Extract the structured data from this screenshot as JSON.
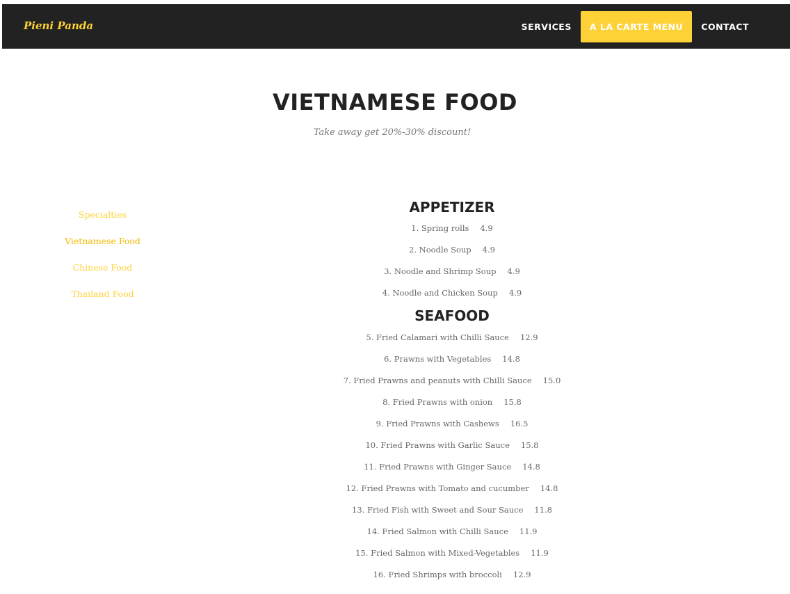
{
  "brand": "Pieni Panda",
  "nav": {
    "items": [
      {
        "label": "SERVICES",
        "active": false
      },
      {
        "label": "A LA CARTE MENU",
        "active": true
      },
      {
        "label": "CONTACT",
        "active": false
      }
    ]
  },
  "hero": {
    "title": "VIETNAMESE FOOD",
    "subtitle": "Take away get 20%-30% discount!"
  },
  "sidebar": {
    "items": [
      {
        "label": "Specialties"
      },
      {
        "label": "Vietnamese Food"
      },
      {
        "label": "Chinese Food"
      },
      {
        "label": "Thailand Food"
      }
    ]
  },
  "categories": [
    {
      "title": "APPETIZER",
      "items": [
        {
          "name": "1. Spring rolls",
          "price": "4.9"
        },
        {
          "name": "2. Noodle Soup",
          "price": "4.9"
        },
        {
          "name": "3. Noodle and Shrimp Soup",
          "price": "4.9"
        },
        {
          "name": "4. Noodle and Chicken Soup",
          "price": "4.9"
        }
      ]
    },
    {
      "title": "SEAFOOD",
      "items": [
        {
          "name": "5. Fried Calamari with Chilli Sauce",
          "price": "12.9"
        },
        {
          "name": "6. Prawns with Vegetables",
          "price": "14.8"
        },
        {
          "name": "7. Fried Prawns and peanuts with Chilli Sauce",
          "price": "15.0"
        },
        {
          "name": "8. Fried Prawns with onion",
          "price": "15.8"
        },
        {
          "name": "9. Fried Prawns with Cashews",
          "price": "16.5"
        },
        {
          "name": "10. Fried Prawns with Garlic Sauce",
          "price": "15.8"
        },
        {
          "name": "11. Fried Prawns with Ginger Sauce",
          "price": "14.8"
        },
        {
          "name": "12. Fried Prawns with Tomato and cucumber",
          "price": "14.8"
        },
        {
          "name": "13. Fried Fish with Sweet and Sour Sauce",
          "price": "11.8"
        },
        {
          "name": "14. Fried Salmon with Chilli Sauce",
          "price": "11.9"
        },
        {
          "name": "15. Fried Salmon with Mixed-Vegetables",
          "price": "11.9"
        },
        {
          "name": "16. Fried Shrimps with broccoli",
          "price": "12.9"
        }
      ]
    }
  ],
  "colors": {
    "accent": "#fed136",
    "navbar": "#222222"
  }
}
